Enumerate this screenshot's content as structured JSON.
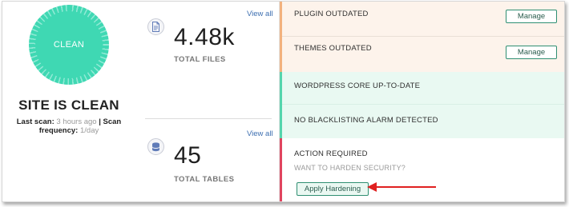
{
  "status": {
    "badge_text": "CLEAN",
    "title": "SITE IS CLEAN",
    "last_scan_label": "Last scan:",
    "last_scan_value": "3 hours ago",
    "separator": "|",
    "frequency_label": "Scan frequency:",
    "frequency_value": "1/day",
    "colors": {
      "ring": "#3fd8b3"
    }
  },
  "stats": {
    "files": {
      "icon": "file-icon",
      "view_all": "View all",
      "value": "4.48k",
      "label": "TOTAL FILES"
    },
    "tables": {
      "icon": "database-icon",
      "view_all": "View all",
      "value": "45",
      "label": "TOTAL TABLES"
    }
  },
  "issues": {
    "plugin": {
      "label": "PLUGIN OUTDATED",
      "button": "Manage"
    },
    "themes": {
      "label": "THEMES OUTDATED",
      "button": "Manage"
    },
    "core": {
      "label": "WORDPRESS CORE UP-TO-DATE"
    },
    "blacklist": {
      "label": "NO BLACKLISTING ALARM DETECTED"
    },
    "action": {
      "label": "ACTION REQUIRED",
      "sub_label": "WANT TO HARDEN SECURITY?",
      "button": "Apply Hardening"
    },
    "colors": {
      "warning": "#f2b27e",
      "ok": "#55d5ad",
      "error": "#e0445f",
      "annotation_arrow": "#e02020"
    }
  }
}
